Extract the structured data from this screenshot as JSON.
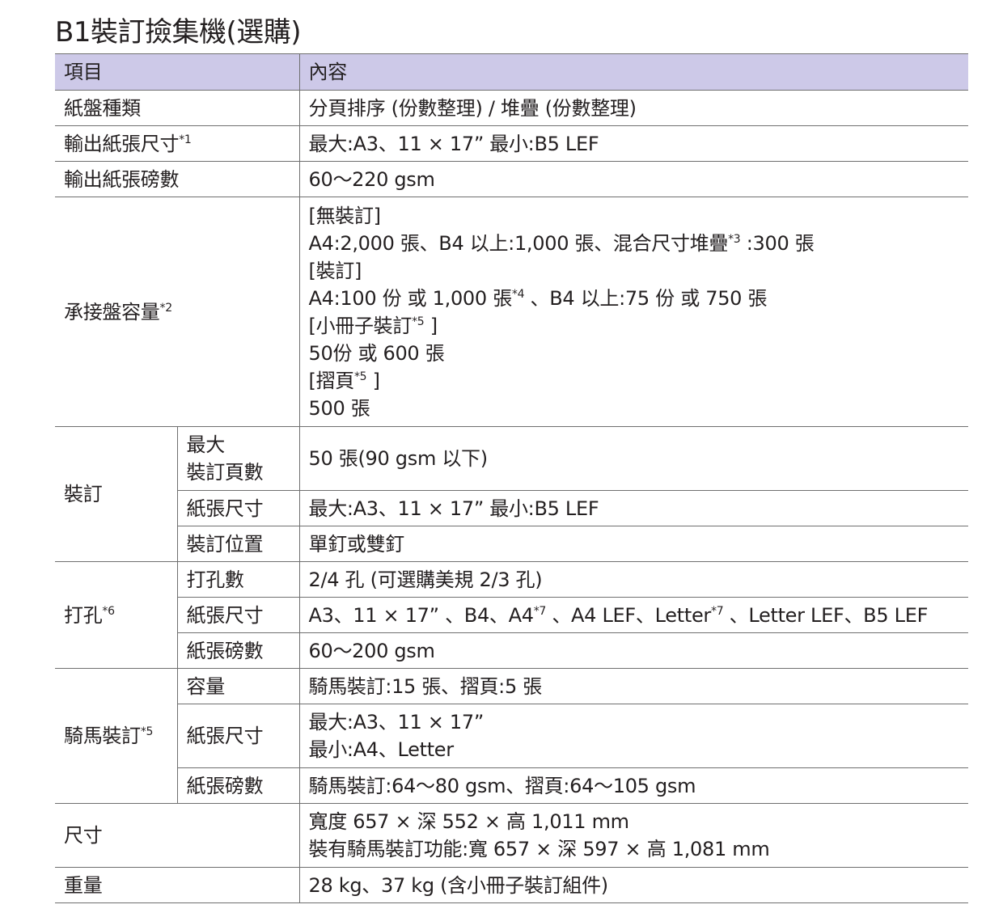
{
  "title": "B1裝訂撿集機(選購)",
  "header": {
    "item": "項目",
    "content": "內容"
  },
  "rows": {
    "tray_type": {
      "label": "紙盤種類",
      "value": "分頁排序 (份數整理) / 堆疊 (份數整理)"
    },
    "output_size": {
      "label": "輸出紙張尺寸",
      "note": "*1",
      "value": "最大:A3、11 × 17” 最小:B5 LEF"
    },
    "output_weight": {
      "label": "輸出紙張磅數",
      "value": "60～220 gsm"
    },
    "capacity": {
      "label": "承接盤容量",
      "note": "*2",
      "l1": "[無裝訂]",
      "l2a": "A4:2,000 張、B4 以上:1,000 張、混合尺寸堆疊",
      "l2n": "*3",
      "l2b": " :300 張",
      "l3": "[裝訂]",
      "l4a": "A4:100 份 或 1,000 張",
      "l4n": "*4",
      "l4b": " 、B4 以上:75 份 或 750 張",
      "l5a": "[小冊子裝訂",
      "l5n": "*5",
      "l5b": " ]",
      "l6": "50份 或 600 張",
      "l7a": "[摺頁",
      "l7n": "*5",
      "l7b": " ]",
      "l8": "500 張"
    },
    "staple": {
      "label": "裝訂",
      "max_label1": "最大",
      "max_label2": "裝訂頁數",
      "max_value": "50 張(90 gsm 以下)",
      "size_label": "紙張尺寸",
      "size_value": "最大:A3、11 × 17” 最小:B5 LEF",
      "pos_label": "裝訂位置",
      "pos_value": "單釘或雙釘"
    },
    "punch": {
      "label": "打孔",
      "note": "*6",
      "holes_label": "打孔數",
      "holes_value": "2/4 孔 (可選購美規 2/3 孔)",
      "size_label": "紙張尺寸",
      "size_a": "A3、11 × 17” 、B4、A4",
      "size_n1": "*7",
      "size_b": " 、A4 LEF、Letter",
      "size_n2": "*7",
      "size_c": " 、Letter LEF、B5 LEF",
      "weight_label": "紙張磅數",
      "weight_value": "60～200 gsm"
    },
    "saddle": {
      "label": "騎馬裝訂",
      "note": "*5",
      "cap_label": "容量",
      "cap_value": "騎馬裝訂:15 張、摺頁:5 張",
      "size_label": "紙張尺寸",
      "size_v1": "最大:A3、11 × 17”",
      "size_v2": "最小:A4、Letter",
      "weight_label": "紙張磅數",
      "weight_value": "騎馬裝訂:64～80 gsm、摺頁:64～105 gsm"
    },
    "dimensions": {
      "label": "尺寸",
      "v1": "寬度 657 × 深 552 × 高 1,011 mm",
      "v2": "裝有騎馬裝訂功能:寬 657 × 深 597 × 高 1,081 mm"
    },
    "weight": {
      "label": "重量",
      "value": "28 kg、37 kg (含小冊子裝訂組件)"
    }
  }
}
